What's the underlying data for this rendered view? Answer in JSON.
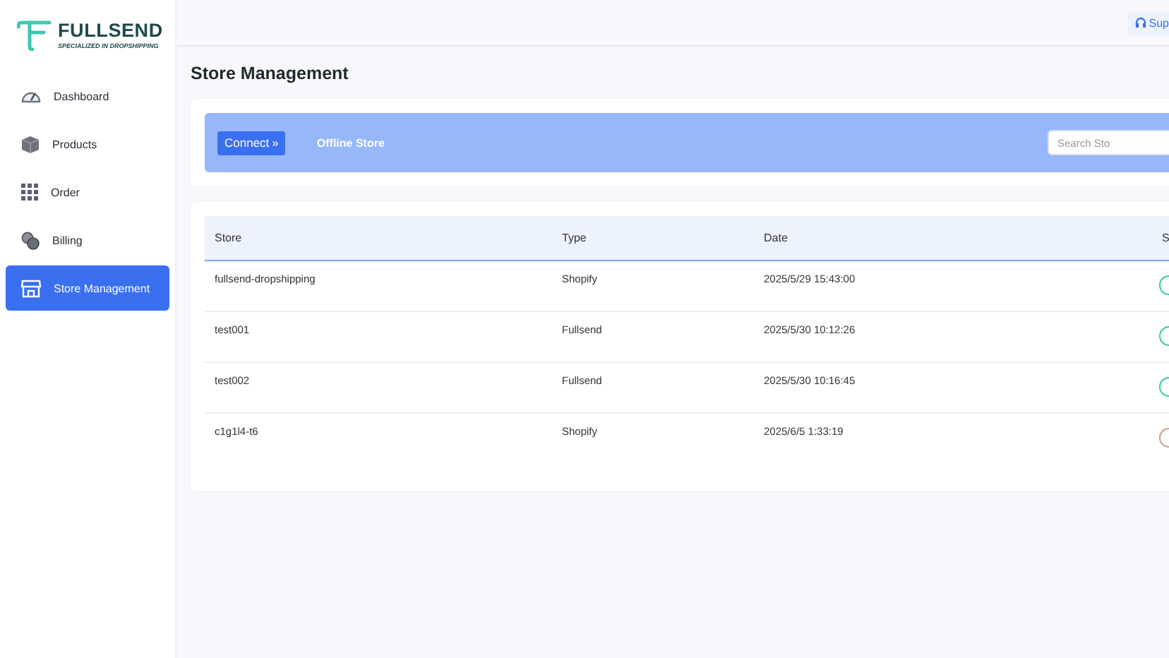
{
  "logo": {
    "name": "FULLSEND",
    "tagline": "SPECIALIZED IN DROPSHIPPING"
  },
  "sidebar": {
    "items": [
      {
        "label": "Dashboard",
        "kind": "gauge",
        "selected": false
      },
      {
        "label": "Products",
        "kind": "box",
        "selected": false
      },
      {
        "label": "Order",
        "kind": "grid",
        "selected": false
      },
      {
        "label": "Billing",
        "kind": "coins",
        "selected": false
      },
      {
        "label": "Store Management",
        "kind": "store",
        "selected": true
      }
    ]
  },
  "topbar": {
    "support": "Sup"
  },
  "page_title": "Store Management",
  "toolbar": {
    "connect": "Connect",
    "connect_icon": "»",
    "offline": "Offline Store",
    "search": {
      "placeholder": "Search Sto"
    }
  },
  "table": {
    "columns": [
      "Store",
      "Type",
      "Date",
      "S"
    ],
    "rows": [
      {
        "store": "fullsend-dropshipping",
        "type": "Shopify",
        "date": "2025/5/29 15:43:00",
        "color": "#3cc8a8"
      },
      {
        "store": "test001",
        "type": "Fullsend",
        "date": "2025/5/30 10:12:26",
        "color": "#3cc8a8"
      },
      {
        "store": "test002",
        "type": "Fullsend",
        "date": "2025/5/30 10:16:45",
        "color": "#3cc8a8"
      },
      {
        "store": "c1g1l4-t6",
        "type": "Shopify",
        "date": "2025/6/5 1:33:19",
        "color": "#c8a08a"
      }
    ]
  }
}
